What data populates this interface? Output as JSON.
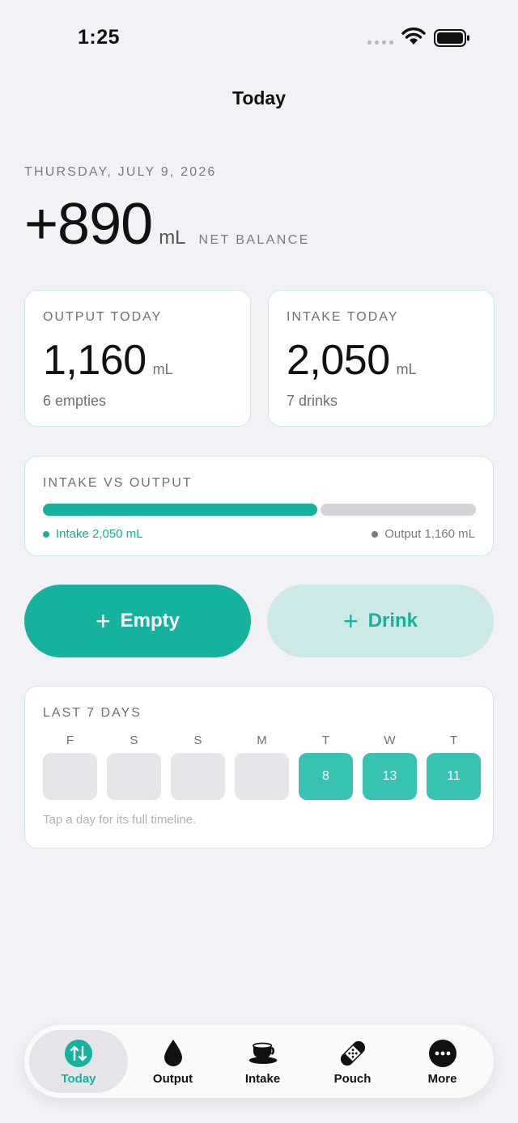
{
  "status_bar": {
    "time": "1:25"
  },
  "nav": {
    "title": "Today"
  },
  "summary": {
    "date": "THURSDAY, JULY 9, 2026",
    "net_value": "+890",
    "net_unit": "mL",
    "net_label": "NET BALANCE"
  },
  "output_card": {
    "label": "OUTPUT TODAY",
    "value": "1,160",
    "unit": "mL",
    "sub": "6 empties"
  },
  "intake_card": {
    "label": "INTAKE TODAY",
    "value": "2,050",
    "unit": "mL",
    "sub": "7 drinks"
  },
  "comparison": {
    "label": "INTAKE VS OUTPUT",
    "intake_ml": 2050,
    "output_ml": 1160,
    "intake_legend": "Intake 2,050 mL",
    "output_legend": "Output 1,160 mL"
  },
  "actions": {
    "empty_label": "Empty",
    "drink_label": "Drink"
  },
  "week": {
    "label": "LAST 7 DAYS",
    "days": [
      {
        "letter": "F",
        "count": ""
      },
      {
        "letter": "S",
        "count": ""
      },
      {
        "letter": "S",
        "count": ""
      },
      {
        "letter": "M",
        "count": ""
      },
      {
        "letter": "T",
        "count": "8"
      },
      {
        "letter": "W",
        "count": "13"
      },
      {
        "letter": "T",
        "count": "11"
      }
    ],
    "hint": "Tap a day for its full timeline."
  },
  "tabs": [
    {
      "label": "Today",
      "icon": "arrows-up-down-icon",
      "active": true
    },
    {
      "label": "Output",
      "icon": "drop-icon",
      "active": false
    },
    {
      "label": "Intake",
      "icon": "cup-icon",
      "active": false
    },
    {
      "label": "Pouch",
      "icon": "bandage-icon",
      "active": false
    },
    {
      "label": "More",
      "icon": "more-icon",
      "active": false
    }
  ],
  "colors": {
    "accent": "#15b39e",
    "accent_light": "#cce9e7",
    "inactive": "#d3d3d8"
  }
}
